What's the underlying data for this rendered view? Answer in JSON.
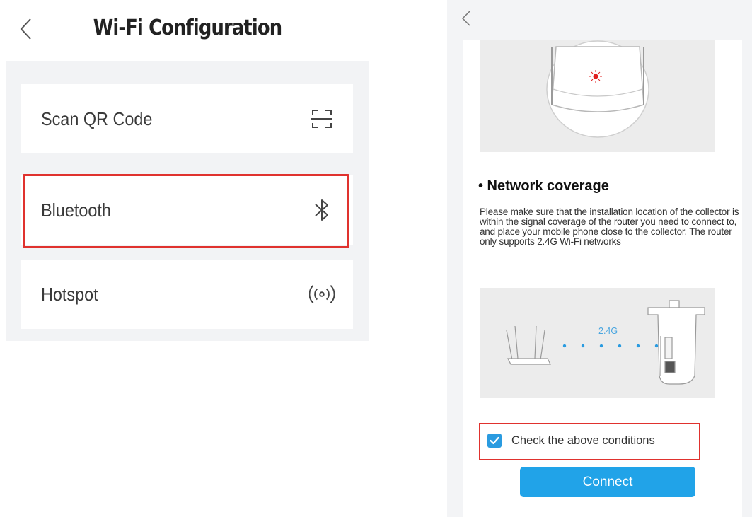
{
  "left_screen": {
    "title": "Wi-Fi Configuration",
    "back_icon": "chevron-left-icon",
    "options": [
      {
        "label": "Scan QR Code",
        "icon": "scan-qr-icon"
      },
      {
        "label": "Bluetooth",
        "icon": "bluetooth-icon"
      },
      {
        "label": "Hotspot",
        "icon": "hotspot-icon"
      }
    ]
  },
  "right_screen": {
    "back_icon": "chevron-left-icon",
    "section_title": "• Network coverage",
    "description": "Please make sure that the installation location of the collector is within the signal coverage of the router you need to connect to, and place your mobile phone close to the collector. The router only supports 2.4G Wi-Fi networks",
    "diagram_label": "2.4G",
    "checkbox_label": "Check the above conditions",
    "checkbox_checked": true,
    "connect_label": "Connect"
  },
  "colors": {
    "highlight": "#e0322e",
    "accent": "#21a3e8",
    "checkbox": "#2a9be0"
  }
}
